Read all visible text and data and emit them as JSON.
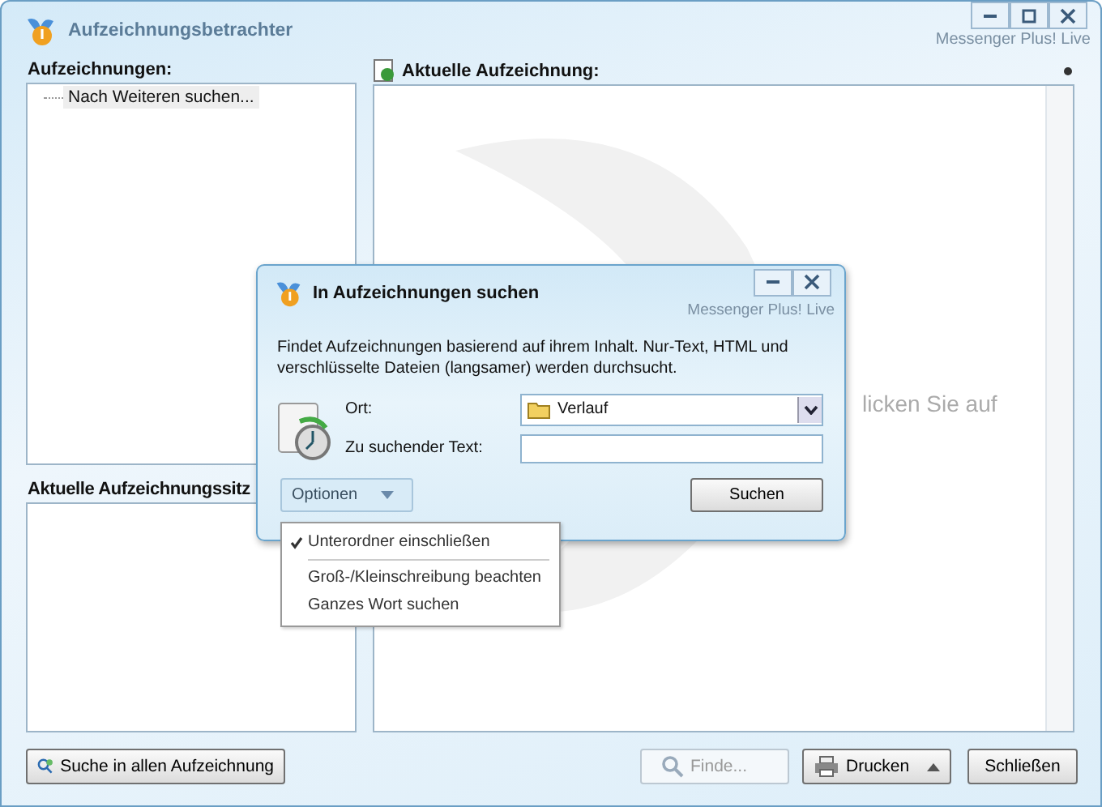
{
  "window": {
    "title": "Aufzeichnungsbetrachter",
    "brand": "Messenger Plus! Live"
  },
  "logs_panel": {
    "label": "Aufzeichnungen:",
    "items": [
      "Nach Weiteren suchen..."
    ]
  },
  "sessions_panel": {
    "label": "Aktuelle Aufzeichnungssitz"
  },
  "current_log": {
    "label": "Aktuelle Aufzeichnung:",
    "hint": "licken Sie auf"
  },
  "bottom_buttons": [
    {
      "label": "Suche in allen Aufzeichnung",
      "kind": "search-all",
      "disabled": false
    },
    {
      "label": "Finde...",
      "kind": "find",
      "disabled": true
    },
    {
      "label": "Drucken",
      "kind": "print",
      "disabled": false
    },
    {
      "label": "Schließen",
      "kind": "close",
      "disabled": false
    }
  ],
  "dialog": {
    "title": "In Aufzeichnungen suchen",
    "brand": "Messenger Plus! Live",
    "description": "Findet Aufzeichnungen basierend auf ihrem Inhalt. Nur-Text, HTML und verschlüsselte Dateien (langsamer) werden durchsucht.",
    "location_label": "Ort:",
    "location_value": "Verlauf",
    "text_label": "Zu suchender Text:",
    "options_button": "Optionen",
    "search_button": "Suchen"
  },
  "options_menu": [
    {
      "label": "Unterordner einschließen",
      "checked": true
    },
    {
      "label": "Groß-/Kleinschreibung beachten",
      "checked": false
    },
    {
      "label": "Ganzes Wort suchen",
      "checked": false
    }
  ]
}
